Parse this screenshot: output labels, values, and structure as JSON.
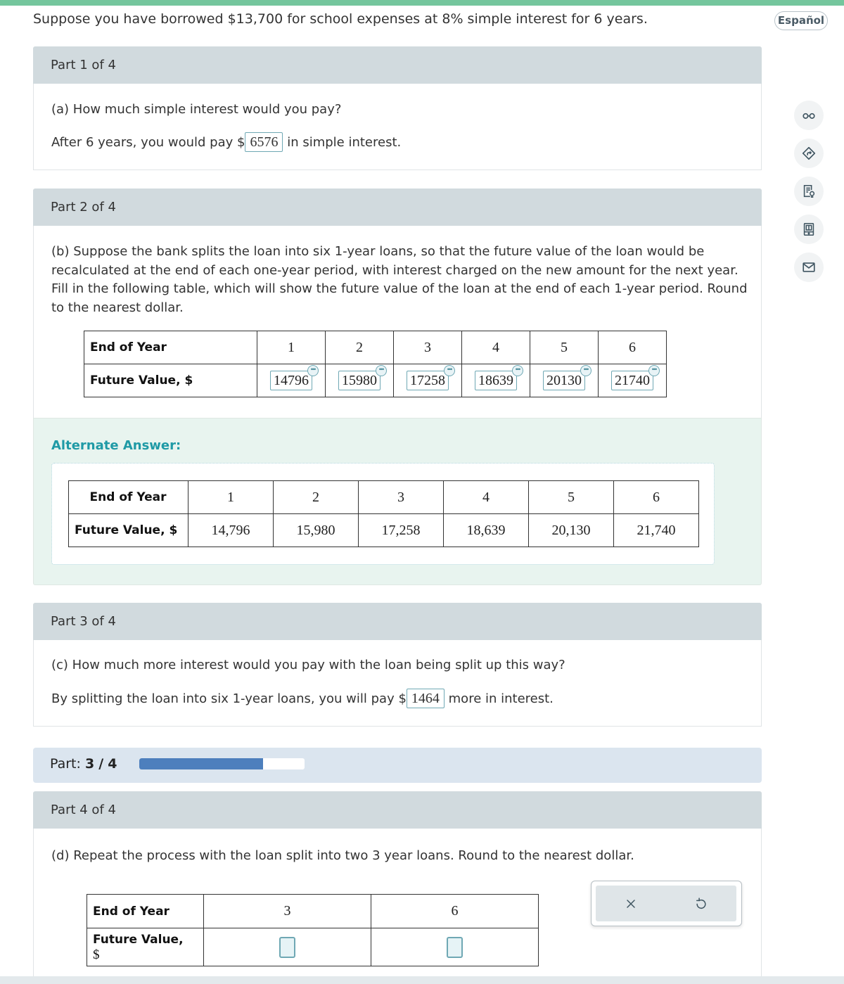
{
  "problem": {
    "intro": "Suppose you have borrowed $13,700 for school expenses at 8% simple interest for 6 years."
  },
  "language_button": "Español",
  "side_tools": [
    {
      "icon": "glasses-icon"
    },
    {
      "icon": "directions-icon"
    },
    {
      "icon": "hint-document-icon"
    },
    {
      "icon": "ebook-icon"
    },
    {
      "icon": "mail-icon"
    }
  ],
  "part1": {
    "header": "Part 1 of 4",
    "question": "(a) How much simple interest would you pay?",
    "answer_prefix": "After 6 years, you would pay $",
    "answer_value": "6576",
    "answer_suffix": "in simple interest."
  },
  "part2": {
    "header": "Part 2 of 4",
    "question": "(b) Suppose the bank splits the loan into six 1-year loans, so that the future value of the loan would be recalculated at the end of each one-year period, with interest charged on the new amount for the next year. Fill in the following table, which will show the future value of the loan at the end of each 1-year period. Round to the nearest dollar.",
    "table": {
      "row1_label": "End of Year",
      "row2_label": "Future Value, $",
      "years": [
        "1",
        "2",
        "3",
        "4",
        "5",
        "6"
      ],
      "values": [
        "14796",
        "15980",
        "17258",
        "18639",
        "20130",
        "21740"
      ]
    },
    "alternate": {
      "title": "Alternate Answer:",
      "row1_label": "End of Year",
      "row2_label": "Future Value, $",
      "years": [
        "1",
        "2",
        "3",
        "4",
        "5",
        "6"
      ],
      "values": [
        "14,796",
        "15,980",
        "17,258",
        "18,639",
        "20,130",
        "21,740"
      ]
    }
  },
  "part3": {
    "header": "Part 3 of 4",
    "question": "(c) How much more interest would you pay with the loan being split up this way?",
    "answer_prefix": "By splitting the loan into six 1-year loans, you will pay $",
    "answer_value": "1464",
    "answer_suffix": "more in interest."
  },
  "progress": {
    "label": "Part:",
    "current": "3",
    "separator": "/",
    "total": "4",
    "fraction": 0.75
  },
  "part4": {
    "header": "Part 4 of 4",
    "question": "(d) Repeat the process with the loan split into two 3 year loans. Round to the nearest dollar.",
    "table": {
      "row1_label": "End of Year",
      "row2_label_line1": "Future Value,",
      "row2_label_line2": "$",
      "years": [
        "3",
        "6"
      ],
      "values": [
        "",
        ""
      ]
    }
  },
  "actions": {
    "clear_icon": "x-icon",
    "undo_icon": "undo-icon"
  },
  "colors": {
    "top_bar": "#74c69d",
    "part_header_bg": "#d1dade",
    "answer_border": "#6fa8b4",
    "alternate_bg": "#e8f4ef",
    "alternate_title": "#1f9aa6",
    "progress_fill": "#4d7fbd",
    "progress_bg": "#dbe5ef"
  }
}
